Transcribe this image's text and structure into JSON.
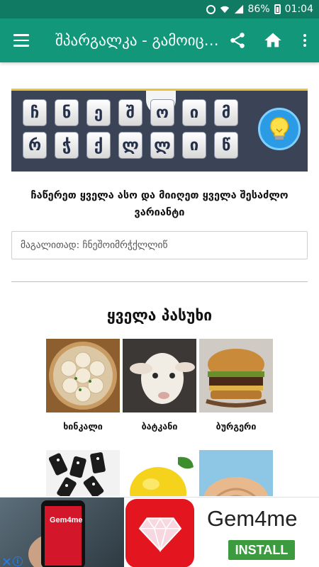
{
  "status_bar": {
    "battery": "86%",
    "time": "01:04",
    "icons": [
      "alarm-icon",
      "wifi-icon",
      "signal-icon",
      "battery-icon"
    ]
  },
  "app_bar": {
    "title": "შპარგალკა - გამოიცანი სიტყვა",
    "actions": [
      "menu-icon",
      "share-icon",
      "home-icon",
      "more-vert-icon"
    ]
  },
  "banner": {
    "row1": [
      "ჩ",
      "ნ",
      "ე",
      "შ",
      "ო",
      "ი",
      "მ"
    ],
    "row2": [
      "რ",
      "ჭ",
      "ქ",
      "ლ",
      "ლ",
      "ი",
      "წ"
    ]
  },
  "instruction": "ჩაწერეთ ყველა ასო და მიიღეთ ყველა შესაძლო ვარიანტი",
  "search": {
    "placeholder": "მაგალითად: ჩნეშოიმრჭქლლიწ",
    "value": ""
  },
  "answers": {
    "heading": "ყველა პასუხი",
    "items": [
      {
        "label": "ხინკალი"
      },
      {
        "label": "ბატკანი"
      },
      {
        "label": "ბურგერი"
      },
      {
        "label": ""
      },
      {
        "label": ""
      },
      {
        "label": ""
      }
    ]
  },
  "ad": {
    "app_name": "Gem4me",
    "phone_label": "Gem4me",
    "install_label": "INSTALL",
    "info_label": "i"
  },
  "colors": {
    "status_bar": "#107a63",
    "app_bar": "#13977b",
    "install": "#3c9b3f",
    "gem_bg": "#e3161f"
  }
}
